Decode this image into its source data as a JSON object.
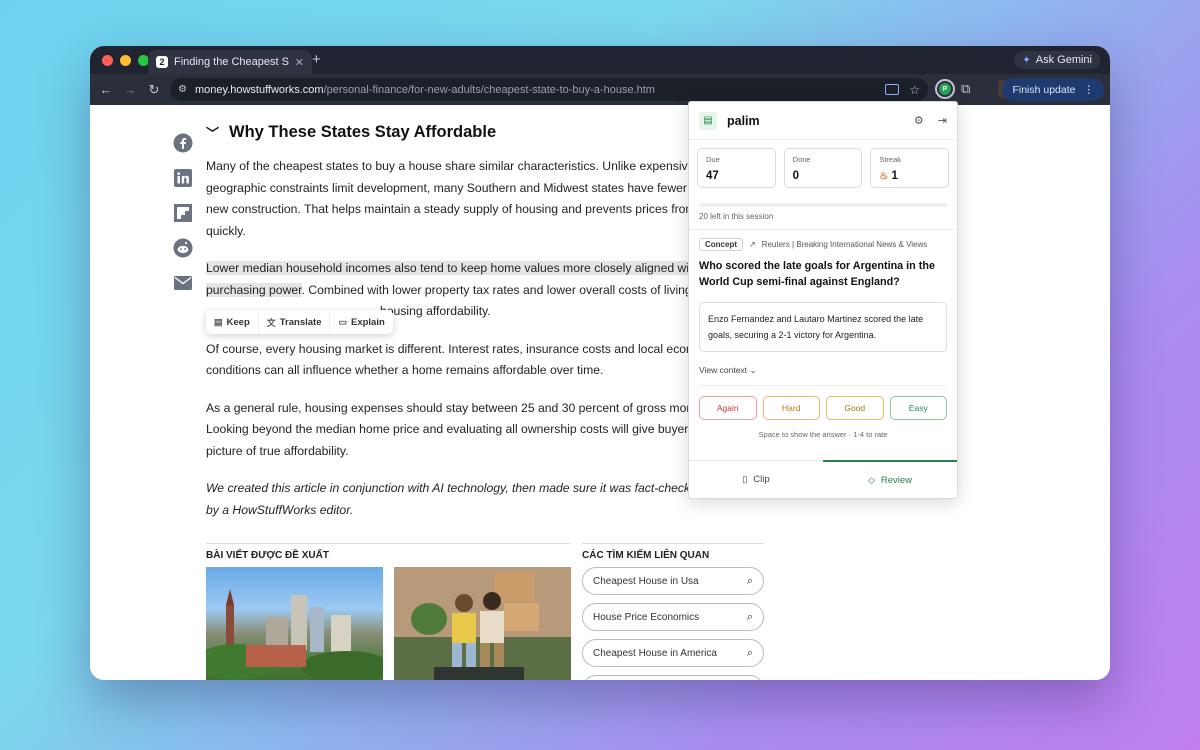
{
  "browser": {
    "tab_title": "Finding the Cheapest State to Buy a House",
    "tab_favicon_letter": "2",
    "new_tab": "+",
    "gemini_label": "Ask Gemini",
    "url_host": "money.howstuffworks.com",
    "url_path": "/personal-finance/for-new-adults/cheapest-state-to-buy-a-house.htm",
    "finish_update": "Finish update",
    "palim_ext_letter": "P"
  },
  "article": {
    "section_title": "Why These States Stay Affordable",
    "paragraphs": [
      [
        "Many of the cheapest states to buy a house share similar characteristics. Unlike expensive",
        "geographic constraints limit development, many Southern and Midwest states have fewer",
        "new construction. That helps maintain a steady supply of housing and prevents prices from",
        "quickly."
      ],
      [
        "Lower median household incomes also tend to keep home values more closely aligned wi",
        "purchasing power",
        ". Combined with lower property tax rates and lower overall costs of living",
        "housing affordability."
      ],
      [
        "Of course, every housing market is different. Interest rates, insurance costs and local econ",
        "conditions can all influence whether a home remains affordable over time."
      ],
      [
        "As a general rule, housing expenses should stay between 25 and 30 percent of gross mon",
        "Looking beyond the median home price and evaluating all ownership costs will give buyers",
        "picture of true affordability."
      ],
      [
        "We created this article in conjunction with AI technology, then made sure it was fact-check",
        "by a HowStuffWorks editor."
      ]
    ]
  },
  "selection_toolbar": {
    "keep": "Keep",
    "translate": "Translate",
    "explain": "Explain"
  },
  "recommended": {
    "title": "BÀI VIẾT ĐƯỢC ĐỀ XUẤT"
  },
  "related_searches": {
    "title": "CÁC TÌM KIẾM LIÊN QUAN",
    "items": [
      "Cheapest House in Usa",
      "House Price Economics",
      "Cheapest House in America"
    ]
  },
  "popup": {
    "name": "palim",
    "stats": {
      "due_label": "Due",
      "due_value": "47",
      "done_label": "Done",
      "done_value": "0",
      "streak_label": "Streak",
      "streak_value": "1"
    },
    "progress_fraction": 0.0,
    "session_text": "20 left in this session",
    "concept_badge": "Concept",
    "source": "Reuters | Breaking International News & Views",
    "question": "Who scored the late goals for Argentina in the World Cup semi-final against England?",
    "answer": "Enzo Fernandez and Lautaro Martinez scored the late goals, securing a 2-1 victory for Argentina.",
    "view_context": "View context",
    "ratings": {
      "again": "Again",
      "hard": "Hard",
      "good": "Good",
      "easy": "Easy"
    },
    "hint": "Space to show the answer · 1-4 to rate",
    "tabs": {
      "clip": "Clip",
      "review": "Review"
    }
  },
  "colors": {
    "accent_green": "#2e7d4f",
    "facebook": "#6b7280",
    "icon_gray": "#6b7280"
  }
}
